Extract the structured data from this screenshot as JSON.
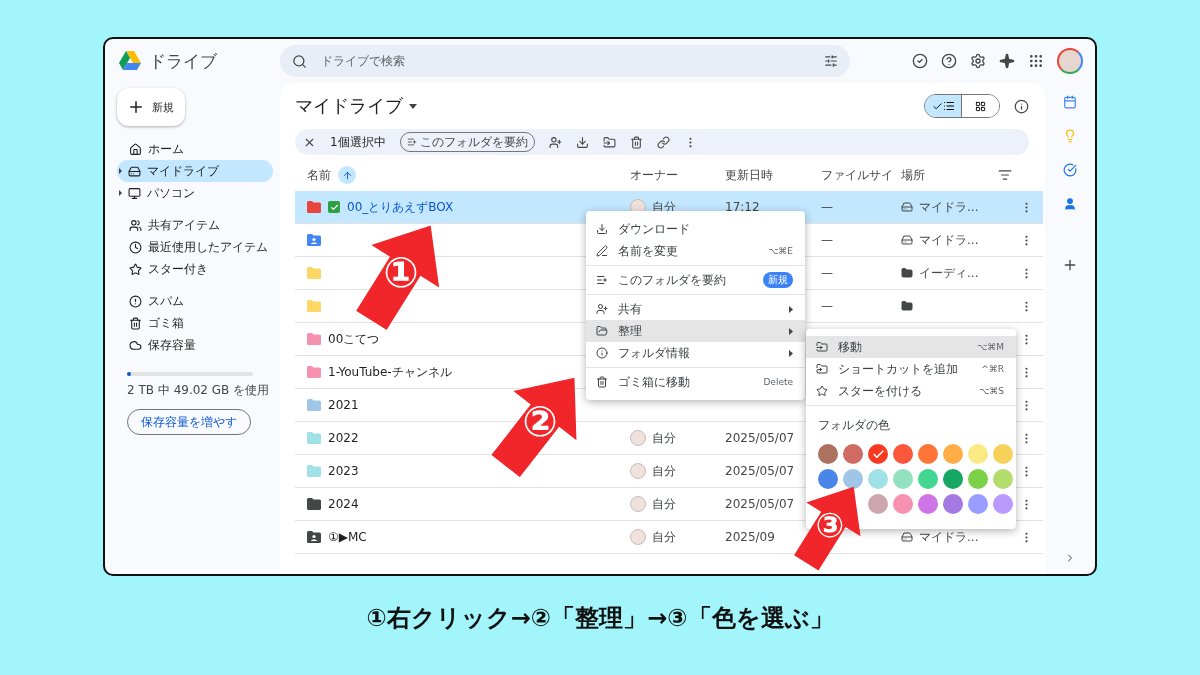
{
  "app": {
    "name": "ドライブ"
  },
  "search": {
    "placeholder": "ドライブで検索"
  },
  "new_button": "新規",
  "sidebar": {
    "groups": [
      [
        {
          "label": "ホーム",
          "kind": "link",
          "selected": false
        },
        {
          "label": "マイドライブ",
          "kind": "tree",
          "selected": true
        },
        {
          "label": "パソコン",
          "kind": "tree",
          "selected": false
        }
      ],
      [
        {
          "label": "共有アイテム",
          "kind": "link",
          "selected": false
        },
        {
          "label": "最近使用したアイテム",
          "kind": "link",
          "selected": false
        },
        {
          "label": "スター付き",
          "kind": "link",
          "selected": false
        }
      ],
      [
        {
          "label": "スパム",
          "kind": "link",
          "selected": false
        },
        {
          "label": "ゴミ箱",
          "kind": "link",
          "selected": false
        },
        {
          "label": "保存容量",
          "kind": "link",
          "selected": false
        }
      ]
    ],
    "storage": {
      "level": 0.03,
      "text": "2 TB 中 49.02 GB を使用",
      "button": "保存容量を増やす"
    }
  },
  "title": "マイドライブ",
  "view_toggle": [
    {
      "selected": true
    },
    {
      "selected": false
    }
  ],
  "selection_bar": {
    "count": "1個選択中",
    "summarize": "このフォルダを要約"
  },
  "columns": [
    "名前",
    "オーナー",
    "更新日時",
    "ファイルサイ",
    "場所"
  ],
  "rows": [
    {
      "name": "00_とりあえずBOX",
      "kind": "folder",
      "color": "#e8453c",
      "tagged": true,
      "selected": true,
      "owner": "自分",
      "modified": "17:12",
      "size": "—",
      "location": {
        "kind": "drive",
        "text": "マイドラ..."
      }
    },
    {
      "kind": "shared",
      "color": "#4285f4",
      "tagged": false,
      "selected": false,
      "size": "—",
      "location": {
        "kind": "drive",
        "text": "マイドラ..."
      }
    },
    {
      "kind": "folder",
      "color": "#fdd663",
      "tagged": false,
      "selected": false,
      "size": "—",
      "location": {
        "kind": "folder",
        "text": "イーディ..."
      }
    },
    {
      "kind": "folder",
      "color": "#fdd663",
      "tagged": false,
      "selected": false,
      "size": "—",
      "location": {
        "kind": "folder"
      }
    },
    {
      "name": "00こてつ",
      "kind": "folder",
      "color": "#f691b2",
      "tagged": false,
      "selected": false
    },
    {
      "name": "1-YouTube-チャンネル",
      "kind": "folder",
      "color": "#f691b2",
      "tagged": false,
      "selected": false
    },
    {
      "name": "2021",
      "kind": "folder",
      "color": "#9fc6e7",
      "tagged": false,
      "selected": false
    },
    {
      "name": "2022",
      "kind": "folder",
      "color": "#9fe1e7",
      "tagged": false,
      "selected": false,
      "owner": "自分",
      "modified": "2025/05/07"
    },
    {
      "name": "2023",
      "kind": "folder",
      "color": "#9fe1e7",
      "tagged": false,
      "selected": false,
      "owner": "自分",
      "modified": "2025/05/07"
    },
    {
      "name": "2024",
      "kind": "folder",
      "color": "#444746",
      "tagged": false,
      "selected": false,
      "owner": "自分",
      "modified": "2025/05/07"
    },
    {
      "name": "①▶MC",
      "kind": "shared",
      "color": "#444746",
      "tagged": false,
      "selected": false,
      "owner": "自分",
      "modified": "2025/09",
      "location": {
        "kind": "drive",
        "text": "マイドラ..."
      }
    }
  ],
  "context_menu": {
    "groups": [
      [
        {
          "label": "ダウンロード",
          "submenu": false,
          "selected": false
        },
        {
          "label": "名前を変更",
          "shortcut": "⌥⌘E",
          "submenu": false,
          "selected": false
        }
      ],
      [
        {
          "label": "このフォルダを要約",
          "badge": "新規",
          "submenu": false,
          "selected": false
        }
      ],
      [
        {
          "label": "共有",
          "submenu": true,
          "selected": false
        },
        {
          "label": "整理",
          "submenu": true,
          "selected": true
        },
        {
          "label": "フォルダ情報",
          "submenu": true,
          "selected": false
        }
      ],
      [
        {
          "label": "ゴミ箱に移動",
          "shortcut": "Delete",
          "submenu": false,
          "selected": false
        }
      ]
    ]
  },
  "submenu": {
    "items": [
      {
        "label": "移動",
        "shortcut": "⌥⌘M",
        "selected": true
      },
      {
        "label": "ショートカットを追加",
        "shortcut": "^⌘R",
        "selected": false
      },
      {
        "label": "スターを付ける",
        "shortcut": "⌥⌘S",
        "selected": false
      }
    ],
    "color_label": "フォルダの色",
    "colors": [
      {
        "color": "#ac725e",
        "selected": false
      },
      {
        "color": "#d06b64",
        "selected": false
      },
      {
        "color": "#f83a22",
        "selected": true
      },
      {
        "color": "#fa573c",
        "selected": false
      },
      {
        "color": "#ff7537",
        "selected": false
      },
      {
        "color": "#ffad46",
        "selected": false
      },
      {
        "color": "#fbe983",
        "selected": false
      },
      {
        "color": "#f7d15a",
        "selected": false
      },
      {
        "color": "#4986e7",
        "selected": false
      },
      {
        "color": "#9fc6e7",
        "selected": false
      },
      {
        "color": "#9fe1e7",
        "selected": false
      },
      {
        "color": "#92e1c0",
        "selected": false
      },
      {
        "color": "#42d692",
        "selected": false
      },
      {
        "color": "#16a765",
        "selected": false
      },
      {
        "color": "#7bd148",
        "selected": false
      },
      {
        "color": "#b3dc6c",
        "selected": false
      },
      {
        "color": "#cca6ac",
        "selected": false
      },
      {
        "color": "#f691b2",
        "selected": false
      },
      {
        "color": "#cd74e6",
        "selected": false
      },
      {
        "color": "#a47ae2",
        "selected": false
      },
      {
        "color": "#9a9cff",
        "selected": false
      },
      {
        "color": "#b99aff",
        "selected": false
      }
    ]
  },
  "arrows": [
    {
      "number": "①"
    },
    {
      "number": "②"
    },
    {
      "number": "③"
    }
  ],
  "caption": "①右クリック→②「整理」→③「色を選ぶ」"
}
